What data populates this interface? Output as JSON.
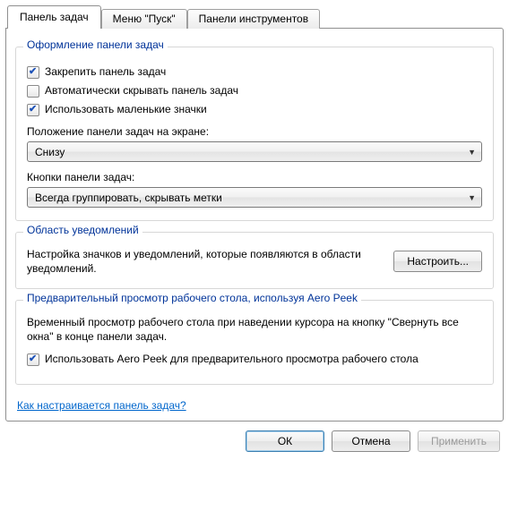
{
  "tabs": {
    "taskbar": "Панель задач",
    "start": "Меню \"Пуск\"",
    "toolbars": "Панели инструментов"
  },
  "group_appearance": {
    "title": "Оформление панели задач",
    "lock": "Закрепить панель задач",
    "autohide": "Автоматически скрывать панель задач",
    "smallicons": "Использовать маленькие значки",
    "position_label": "Положение панели задач на экране:",
    "position_value": "Снизу",
    "buttons_label": "Кнопки панели задач:",
    "buttons_value": "Всегда группировать, скрывать метки"
  },
  "group_notify": {
    "title": "Область уведомлений",
    "text": "Настройка значков и уведомлений, которые появляются в области уведомлений.",
    "btn": "Настроить..."
  },
  "group_aero": {
    "title": "Предварительный просмотр рабочего стола, используя Aero Peek",
    "text": "Временный просмотр рабочего стола при наведении курсора на кнопку \"Свернуть все окна\" в конце панели задач.",
    "use_aero": "Использовать Aero Peek для предварительного просмотра рабочего стола"
  },
  "help": "Как настраивается панель задач?",
  "dialog": {
    "ok": "ОК",
    "cancel": "Отмена",
    "apply": "Применить"
  }
}
